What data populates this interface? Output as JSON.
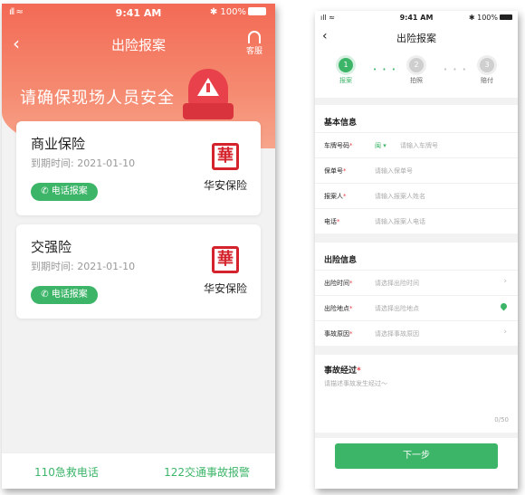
{
  "left": {
    "status": {
      "signal": "ıll ≈",
      "time": "9:41 AM",
      "battery": "✱ 100%"
    },
    "nav": {
      "back": "‹",
      "title": "出险报案",
      "service": "客服"
    },
    "hero_text": "请确保现场人员安全",
    "cards": [
      {
        "name": "商业保险",
        "expire": "到期时间: 2021-01-10",
        "call": "电话报案",
        "brand": "华安保险",
        "seal": "華"
      },
      {
        "name": "交强险",
        "expire": "到期时间: 2021-01-10",
        "call": "电话报案",
        "brand": "华安保险",
        "seal": "華"
      }
    ],
    "bottom": {
      "emergency": "110急救电话",
      "traffic": "122交通事故报警"
    }
  },
  "right": {
    "status": {
      "signal": "ıll ≈",
      "time": "9:41 AM",
      "battery": "✱ 100%"
    },
    "nav": {
      "back": "‹",
      "title": "出险报案"
    },
    "steps": [
      {
        "num": "1",
        "label": "报案"
      },
      {
        "num": "2",
        "label": "拍照"
      },
      {
        "num": "3",
        "label": "赔付"
      }
    ],
    "basic": {
      "title": "基本信息",
      "plate_label": "车牌号码",
      "plate_prefix": "闽 ▾",
      "plate_placeholder": "请输入车牌号",
      "policy_label": "保单号",
      "policy_placeholder": "请输入保单号",
      "reporter_label": "报案人",
      "reporter_placeholder": "请输入报案人姓名",
      "phone_label": "电话",
      "phone_placeholder": "请输入报案人电话"
    },
    "accident": {
      "title": "出险信息",
      "time_label": "出险时间",
      "time_placeholder": "请选择出险时间",
      "place_label": "出险地点",
      "place_placeholder": "请选择出险地点",
      "reason_label": "事故原因",
      "reason_placeholder": "请选择事故原因"
    },
    "desc": {
      "title": "事故经过",
      "placeholder": "请描述事故发生经过～",
      "counter": "0/50"
    },
    "next": "下一步",
    "required": "*"
  },
  "colors": {
    "accent": "#3db569",
    "hero": "#f36a55",
    "danger": "#e9414b"
  }
}
